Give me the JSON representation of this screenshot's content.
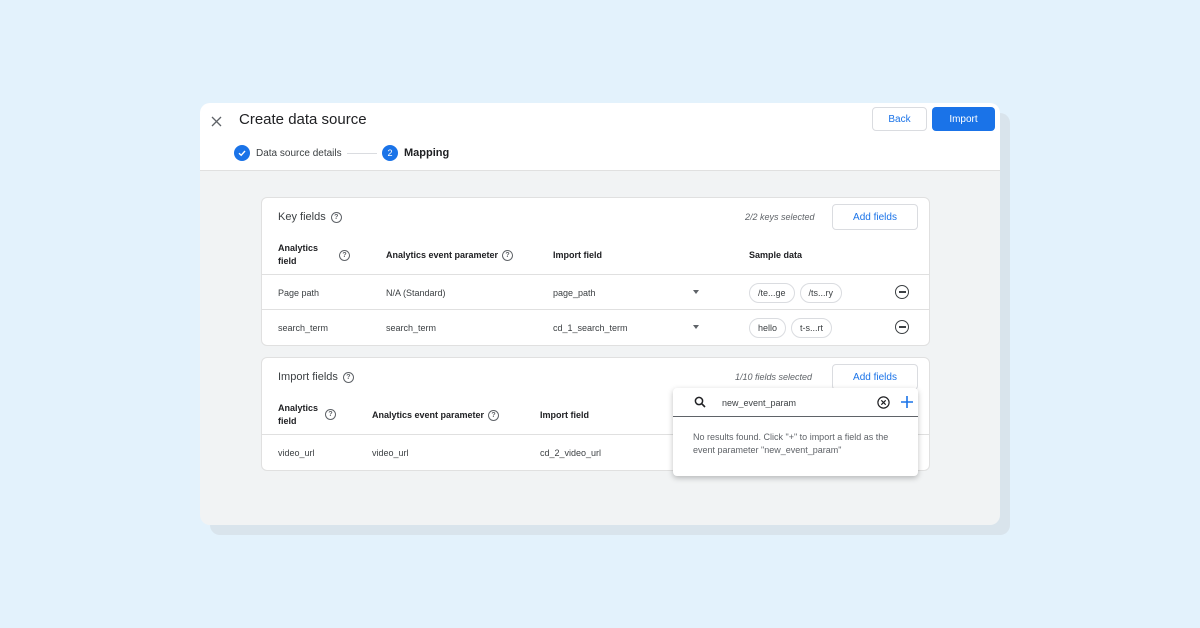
{
  "dialog": {
    "title": "Create data source",
    "back_label": "Back",
    "import_label": "Import"
  },
  "stepper": {
    "step1": {
      "number": "✓",
      "label": "Data source details"
    },
    "step2": {
      "number": "2",
      "label": "Mapping"
    }
  },
  "key_fields": {
    "title": "Key fields",
    "count": "2/2 keys selected",
    "add_label": "Add fields",
    "headers": {
      "analytics_field": "Analytics field",
      "event_parameter": "Analytics event parameter",
      "import_field": "Import field",
      "sample_data": "Sample data"
    },
    "rows": [
      {
        "analytics_field": "Page path",
        "event_parameter": "N/A (Standard)",
        "import_field": "page_path",
        "samples": [
          "/te...ge",
          "/ts...ry"
        ]
      },
      {
        "analytics_field": "search_term",
        "event_parameter": "search_term",
        "import_field": "cd_1_search_term",
        "samples": [
          "hello",
          "t-s...rt"
        ]
      }
    ]
  },
  "import_fields": {
    "title": "Import fields",
    "count": "1/10 fields selected",
    "add_label": "Add fields",
    "headers": {
      "analytics_field": "Analytics field",
      "event_parameter": "Analytics event parameter",
      "import_field": "Import field"
    },
    "rows": [
      {
        "analytics_field": "video_url",
        "event_parameter": "video_url",
        "import_field": "cd_2_video_url"
      }
    ]
  },
  "search_popup": {
    "query": "new_event_param",
    "message": "No results found. Click \"+\" to import a field as the event parameter \"new_event_param\""
  },
  "colors": {
    "page_background": "#e3f2fc",
    "accent": "#1a73e8",
    "panel_background": "#f1f3f4"
  }
}
